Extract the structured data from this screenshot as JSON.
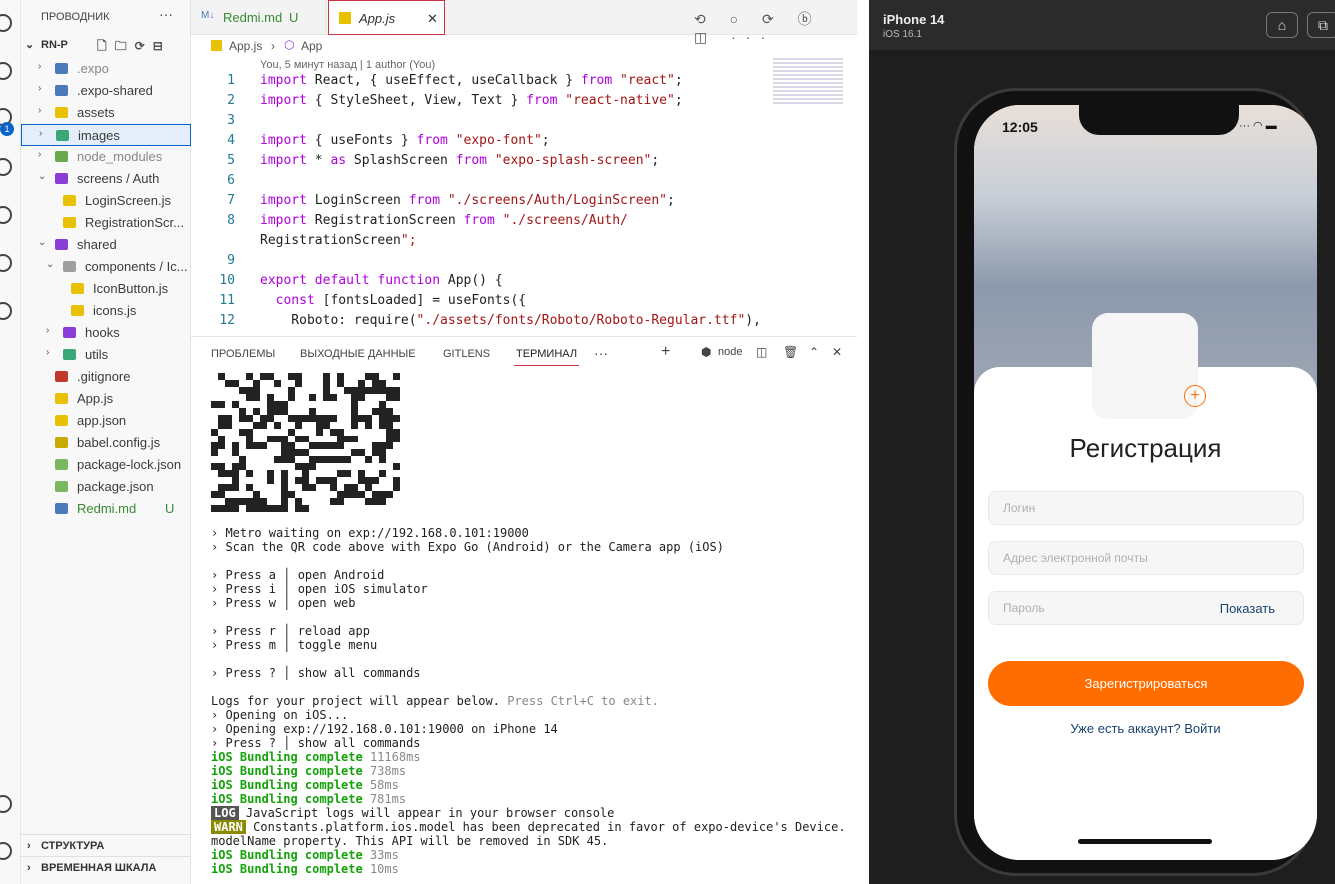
{
  "sidebar": {
    "title": "ПРОВОДНИК",
    "more": "···",
    "root": "RN-P",
    "items": [
      {
        "label": ".expo",
        "color": "#888888"
      },
      {
        "label": ".expo-shared",
        "color": "#3b3b3b"
      },
      {
        "label": "assets",
        "color": "#3b3b3b"
      },
      {
        "label": "images",
        "color": "#3b3b3b"
      },
      {
        "label": "node_modules",
        "color": "#888888"
      },
      {
        "label": "screens / Auth",
        "color": "#3b3b3b"
      },
      {
        "label": "LoginScreen.js",
        "color": "#3b3b3b"
      },
      {
        "label": "RegistrationScr...",
        "color": "#3b3b3b"
      },
      {
        "label": "shared",
        "color": "#3b3b3b"
      },
      {
        "label": "components / Ic...",
        "color": "#3b3b3b"
      },
      {
        "label": "IconButton.js",
        "color": "#3b3b3b"
      },
      {
        "label": "icons.js",
        "color": "#3b3b3b"
      },
      {
        "label": "hooks",
        "color": "#3b3b3b"
      },
      {
        "label": "utils",
        "color": "#3b3b3b"
      },
      {
        "label": ".gitignore",
        "color": "#3b3b3b"
      },
      {
        "label": "App.js",
        "color": "#3b3b3b"
      },
      {
        "label": "app.json",
        "color": "#3b3b3b"
      },
      {
        "label": "babel.config.js",
        "color": "#3b3b3b"
      },
      {
        "label": "package-lock.json",
        "color": "#3b3b3b"
      },
      {
        "label": "package.json",
        "color": "#3b3b3b"
      },
      {
        "label": "Redmi.md",
        "color": "#388a34"
      }
    ],
    "redmi_status": "U",
    "sections": [
      "СТРУКТУРА",
      "ВРЕМЕННАЯ ШКАЛА"
    ]
  },
  "activity": {
    "badge": "1"
  },
  "editor": {
    "tabs": [
      {
        "label": "Redmi.md",
        "status": "U"
      },
      {
        "label": "App.js",
        "close": "✕"
      }
    ],
    "actions": "⟲ ○ ⟳ ⓑ ◫ ···",
    "breadcrumb": [
      "App.js",
      "App"
    ],
    "blame": "You, 5 минут назад | 1 author (You)",
    "lines": [
      {
        "n": "1",
        "t": "import React, { useEffect, useCallback } from \"react\";"
      },
      {
        "n": "2",
        "t": "import { StyleSheet, View, Text } from \"react-native\";"
      },
      {
        "n": "3",
        "t": ""
      },
      {
        "n": "4",
        "t": "import { useFonts } from \"expo-font\";"
      },
      {
        "n": "5",
        "t": "import * as SplashScreen from \"expo-splash-screen\";"
      },
      {
        "n": "6",
        "t": ""
      },
      {
        "n": "7",
        "t": "import LoginScreen from \"./screens/Auth/LoginScreen\";"
      },
      {
        "n": "8",
        "t": "import RegistrationScreen from \"./screens/Auth/"
      },
      {
        "n": "",
        "t": "RegistrationScreen\";"
      },
      {
        "n": "9",
        "t": ""
      },
      {
        "n": "10",
        "t": "export default function App() {"
      },
      {
        "n": "11",
        "t": "  const [fontsLoaded] = useFonts({"
      },
      {
        "n": "12",
        "t": "    Roboto: require(\"./assets/fonts/Roboto/Roboto-Regular.ttf\"),"
      }
    ]
  },
  "panel": {
    "tabs": [
      "ПРОБЛЕМЫ",
      "ВЫХОДНЫЕ ДАННЫЕ",
      "GITLENS",
      "ТЕРМИНАЛ",
      "···"
    ],
    "shell": "node",
    "terminal": {
      "metro": "› Metro waiting on exp://192.168.0.101:19000",
      "scan": "› Scan the QR code above with Expo Go (Android) or the Camera app (iOS)",
      "press_a": "› Press a │ open Android",
      "press_i": "› Press i │ open iOS simulator",
      "press_w": "› Press w │ open web",
      "press_r": "› Press r │ reload app",
      "press_m": "› Press m │ toggle menu",
      "press_q": "› Press ? │ show all commands",
      "logs": "Logs for your project will appear below.",
      "logs_hint": "Press Ctrl+C to exit.",
      "opening_ios": "› Opening on iOS...",
      "opening_exp": "› Opening exp://192.168.0.101:19000 on iPhone 14",
      "press_q2": "› Press ? │ show all commands",
      "bundling_label": "iOS Bundling complete",
      "bundles": [
        "11168ms",
        "738ms",
        "58ms",
        "781ms"
      ],
      "log_badge": "LOG",
      "log_text": "JavaScript logs will appear in your browser console",
      "warn_badge": "WARN",
      "warn_text": "Constants.platform.ios.model has been deprecated in favor of expo-device's Device.",
      "warn_text2": "modelName property. This API will be removed in SDK 45.",
      "bundles2": [
        "33ms",
        "10ms"
      ]
    }
  },
  "simulator": {
    "device": "iPhone 14",
    "os": "iOS 16.1",
    "time": "12:05",
    "status_icons": "··· ◠ ▬",
    "title": "Регистрация",
    "login_placeholder": "Логин",
    "email_placeholder": "Адрес электронной почты",
    "password_placeholder": "Пароль",
    "show_password": "Показать",
    "register_button": "Зарегистрироваться",
    "login_link": "Уже есть аккаунт? Войти",
    "accent": "#ff6c00",
    "link_color": "#1b4371"
  }
}
